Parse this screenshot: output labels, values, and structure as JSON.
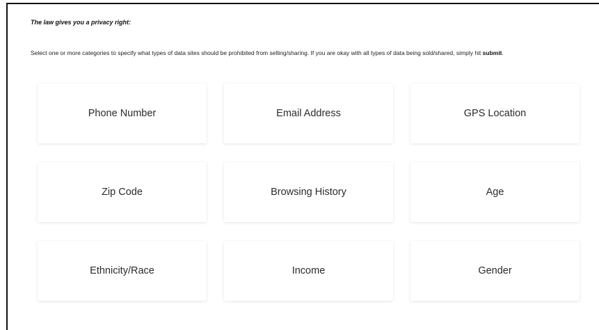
{
  "page": {
    "heading": "The law gives you a privacy right:",
    "instructions": {
      "text_before": "Select one or more categories to specify what types of data sites should be prohibited from selling/sharing. If you are okay with all types of data being sold/shared, simply hit ",
      "emphasis": "submit",
      "text_after": "."
    }
  },
  "categories": [
    {
      "label": "Phone Number"
    },
    {
      "label": "Email Address"
    },
    {
      "label": "GPS Location"
    },
    {
      "label": "Zip Code"
    },
    {
      "label": "Browsing History"
    },
    {
      "label": "Age"
    },
    {
      "label": "Ethnicity/Race"
    },
    {
      "label": "Income"
    },
    {
      "label": "Gender"
    }
  ]
}
